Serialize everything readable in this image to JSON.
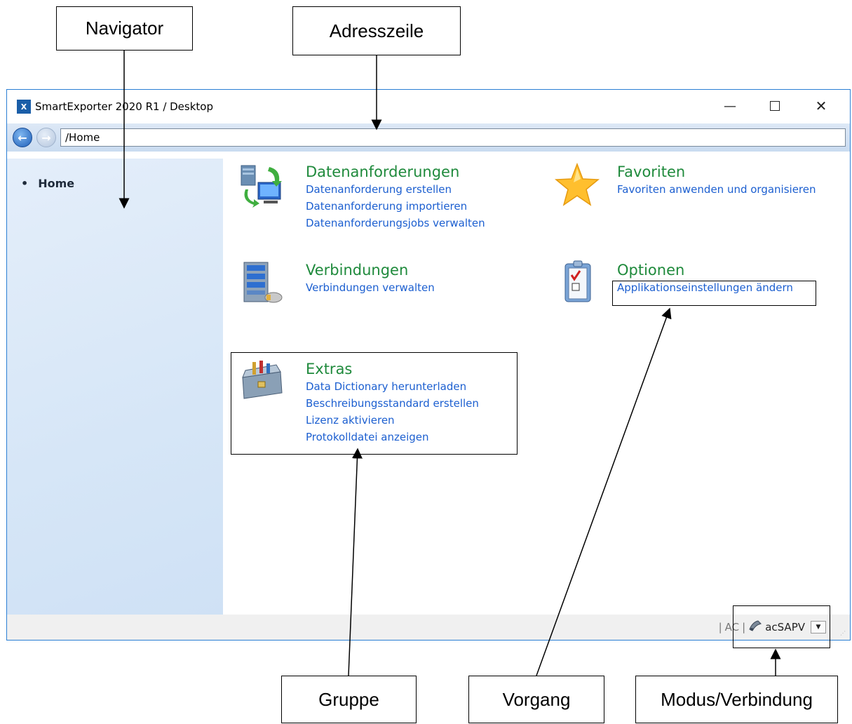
{
  "callouts": {
    "navigator": "Navigator",
    "adresszeile": "Adresszeile",
    "gruppe": "Gruppe",
    "vorgang": "Vorgang",
    "modus": "Modus/Verbindung"
  },
  "window": {
    "logo": "X",
    "title": "SmartExporter 2020 R1 / Desktop"
  },
  "address": {
    "path": "/Home"
  },
  "navigator": {
    "items": [
      {
        "label": "Home"
      }
    ]
  },
  "groups": {
    "datenanforderungen": {
      "title": "Datenanforderungen",
      "links": [
        "Datenanforderung erstellen",
        "Datenanforderung importieren",
        "Datenanforderungsjobs verwalten"
      ]
    },
    "favoriten": {
      "title": "Favoriten",
      "links": [
        "Favoriten anwenden und organisieren"
      ]
    },
    "verbindungen": {
      "title": "Verbindungen",
      "links": [
        "Verbindungen verwalten"
      ]
    },
    "optionen": {
      "title": "Optionen",
      "links": [
        "Applikationseinstellungen ändern"
      ]
    },
    "extras": {
      "title": "Extras",
      "links": [
        "Data Dictionary herunterladen",
        "Beschreibungsstandard erstellen",
        "Lizenz aktivieren",
        "Protokolldatei anzeigen"
      ]
    }
  },
  "statusbar": {
    "separator": "|",
    "mode": "AC",
    "connection": "acSAPV"
  },
  "colors": {
    "group_title": "#1f8a3c",
    "link": "#1c5fd0",
    "window_border": "#2b7fd4"
  }
}
